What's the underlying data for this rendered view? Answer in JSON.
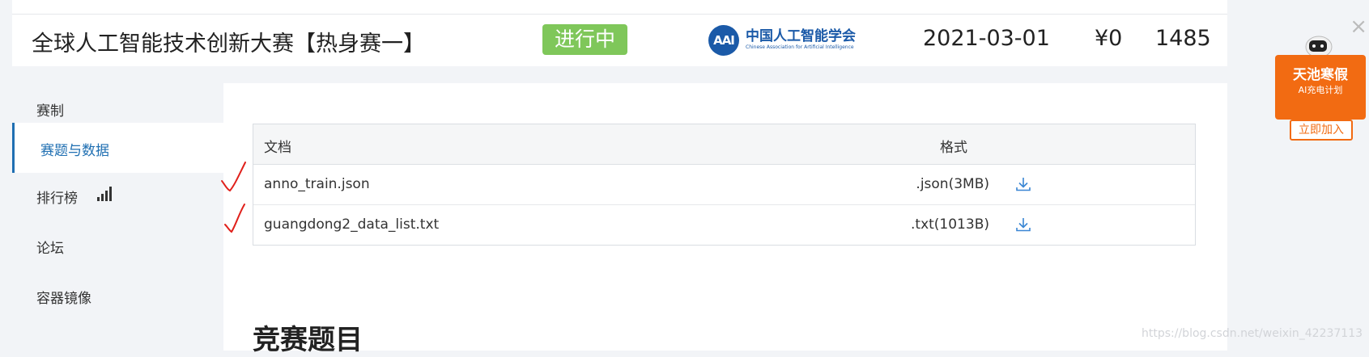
{
  "header": {
    "title": "全球人工智能技术创新大赛【热身赛一】",
    "status": "进行中",
    "logo_cn": "中国人工智能学会",
    "logo_en": "Chinese Association for Artificial Intelligence",
    "logo_mark": "AAI",
    "date": "2021-03-01",
    "price": "¥0",
    "count": "1485"
  },
  "sidebar": {
    "items": [
      {
        "label": "赛制"
      },
      {
        "label": "赛题与数据",
        "active": true
      },
      {
        "label": "排行榜",
        "icon": "bar-chart-icon"
      },
      {
        "label": "论坛"
      },
      {
        "label": "容器镜像"
      }
    ]
  },
  "table": {
    "headers": {
      "doc": "文档",
      "format": "格式"
    },
    "rows": [
      {
        "name": "anno_train.json",
        "format": ".json(3MB)",
        "icon": "download-icon"
      },
      {
        "name": "guangdong2_data_list.txt",
        "format": ".txt(1013B)",
        "icon": "download-icon"
      }
    ]
  },
  "section_title": "竞赛题目",
  "ad": {
    "title": "天池寒假",
    "subtitle": "AI充电计划",
    "button": "立即加入",
    "close": "×"
  },
  "watermark": "https://blog.csdn.net/weixin_42237113",
  "colors": {
    "status_green": "#7fc75a",
    "accent_blue": "#1f6fb2",
    "ad_orange": "#f26b12",
    "check_red": "#e0201b"
  }
}
